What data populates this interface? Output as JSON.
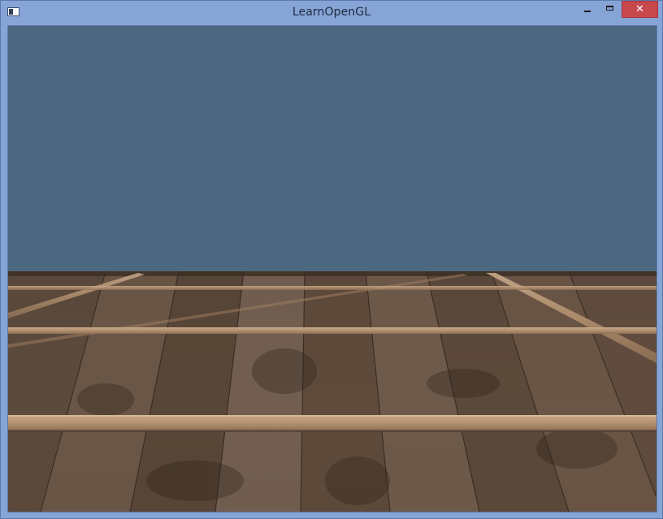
{
  "window": {
    "title": "LearnOpenGL",
    "icon": "app-window-icon",
    "controls": {
      "minimize_icon": "minimize-icon",
      "maximize_icon": "maximize-icon",
      "close_glyph": "✕"
    }
  },
  "scene": {
    "clear_color": "#4c6780",
    "floor_texture": "wooden-plank-floor",
    "horizon_fraction": 0.505
  }
}
